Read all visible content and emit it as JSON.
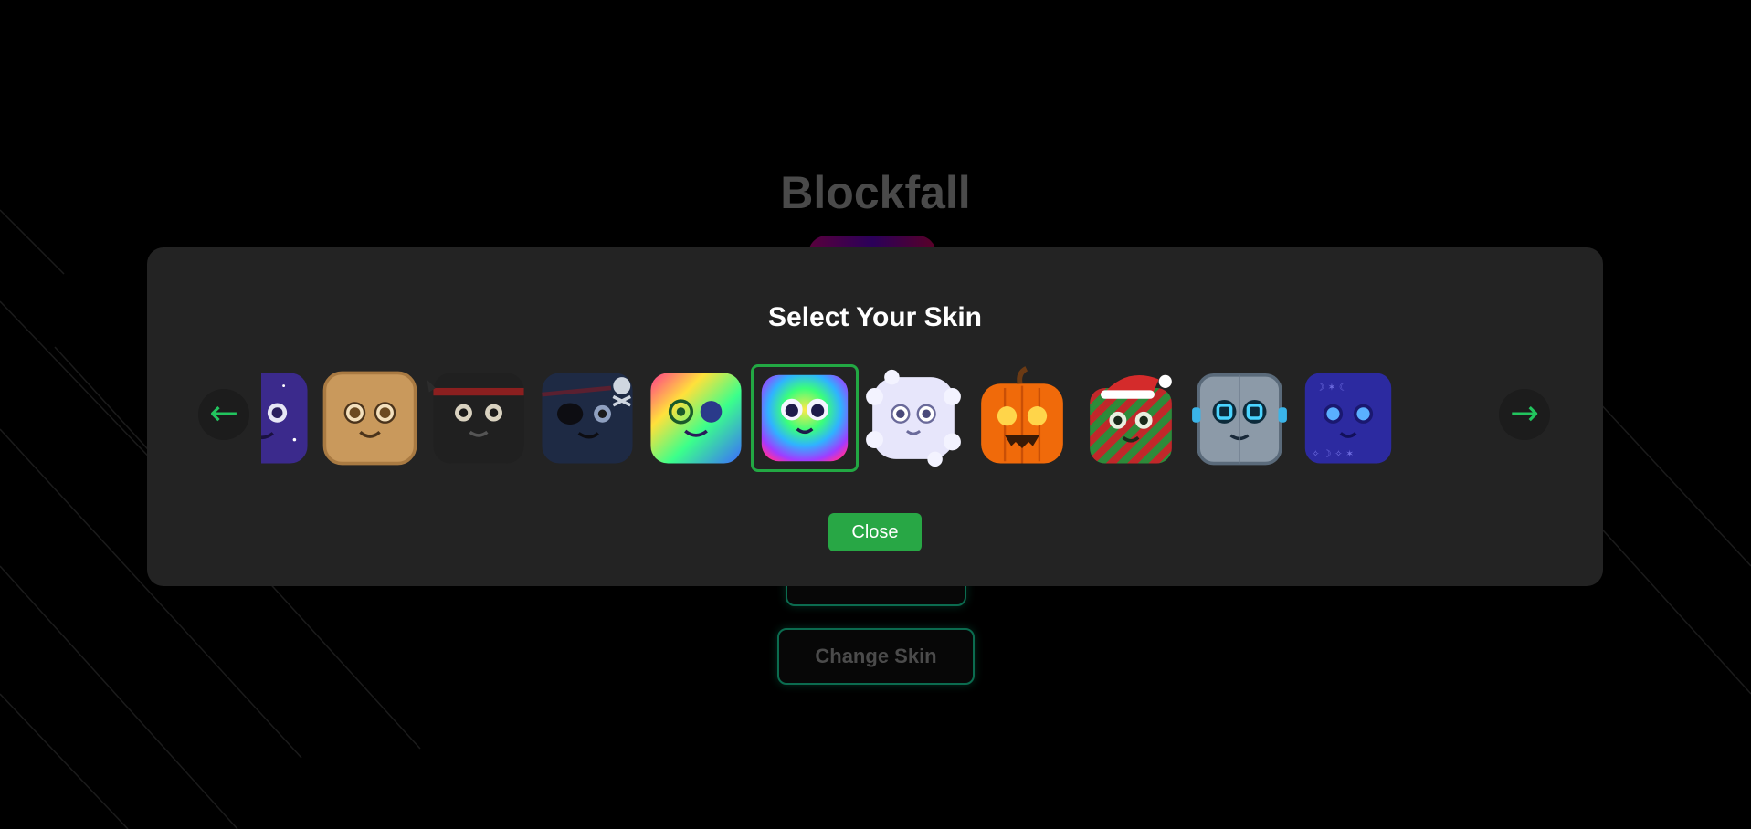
{
  "game": {
    "title": "Blockfall"
  },
  "menu": {
    "play_label": "",
    "change_skin_label": "Change Skin"
  },
  "skin_modal": {
    "title": "Select Your Skin",
    "prev_arrow": "←",
    "next_arrow": "→",
    "close_label": "Close",
    "selected_skin": "rainbow",
    "skins": [
      {
        "id": "galaxy",
        "icon": "galaxy-skin-icon"
      },
      {
        "id": "sand",
        "icon": "sand-skin-icon"
      },
      {
        "id": "ninja",
        "icon": "ninja-skin-icon"
      },
      {
        "id": "pirate",
        "icon": "pirate-skin-icon"
      },
      {
        "id": "psychedelic",
        "icon": "psychedelic-skin-icon"
      },
      {
        "id": "rainbow",
        "icon": "rainbow-skin-icon"
      },
      {
        "id": "cloud",
        "icon": "cloud-skin-icon"
      },
      {
        "id": "pumpkin",
        "icon": "pumpkin-skin-icon"
      },
      {
        "id": "christmas",
        "icon": "christmas-skin-icon"
      },
      {
        "id": "robot",
        "icon": "robot-skin-icon"
      },
      {
        "id": "mystic",
        "icon": "mystic-skin-icon"
      }
    ]
  },
  "colors": {
    "accent": "#22c55e",
    "close_button": "#28a745",
    "modal_bg": "#232323"
  }
}
